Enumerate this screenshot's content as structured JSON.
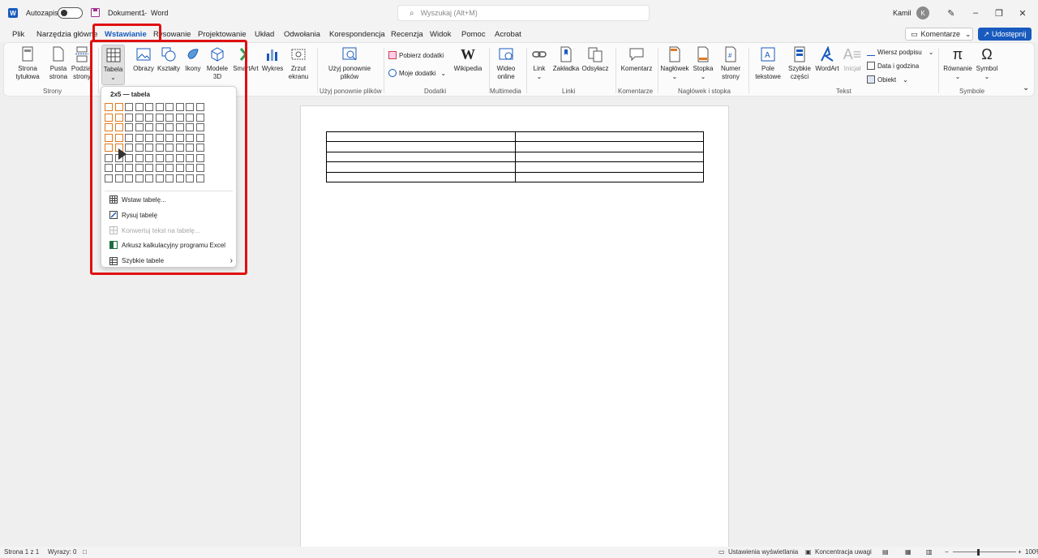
{
  "titlebar": {
    "autosave_label": "Autozapis",
    "doc_title": "Dokument1",
    "separator": "-",
    "app_name": "Word",
    "search_placeholder": "Wyszukaj (Alt+M)",
    "user_name": "Kamil",
    "avatar_letter": "K"
  },
  "tabs": [
    "Plik",
    "Narzędzia główne",
    "Wstawianie",
    "Rysowanie",
    "Projektowanie",
    "Układ",
    "Odwołania",
    "Korespondencja",
    "Recenzja",
    "Widok",
    "Pomoc",
    "Acrobat"
  ],
  "header_buttons": {
    "comments": "Komentarze",
    "share": "Udostępnij"
  },
  "ribbon": {
    "strona_tytulowa": "Strona tytułowa",
    "pusta_strona": "Pusta strona",
    "podzial_strony": "Podział strony",
    "tabela": "Tabela",
    "obrazy": "Obrazy",
    "ksztalty": "Kształty",
    "ikony": "Ikony",
    "modele_3d": "Modele 3D",
    "smartart": "SmartArt",
    "wykres": "Wykres",
    "zrzut_ekranu": "Zrzut ekranu",
    "uzyj_ponownie": "Użyj ponownie plików",
    "pobierz_dodatki": "Pobierz dodatki",
    "moje_dodatki": "Moje dodatki",
    "wikipedia": "Wikipedia",
    "wideo_online": "Wideo online",
    "link": "Link",
    "zakladka": "Zakładka",
    "odsylacz": "Odsyłacz",
    "komentarz": "Komentarz",
    "naglowek": "Nagłówek",
    "stopka": "Stopka",
    "numer_strony": "Numer strony",
    "pole_tekstowe": "Pole tekstowe",
    "szybkie_czesci": "Szybkie części",
    "wordart": "WordArt",
    "inicjal": "Inicjał",
    "wiersz_podpisu": "Wiersz podpisu",
    "data_i_godzina": "Data i godzina",
    "obiekt": "Obiekt",
    "rownanie": "Równanie",
    "symbol": "Symbol",
    "groups": {
      "strony": "Strony",
      "uzyj_ponownie_plikow": "Użyj ponownie plików",
      "dodatki": "Dodatki",
      "multimedia": "Multimedia",
      "linki": "Linki",
      "komentarze": "Komentarze",
      "naglowek_i_stopka": "Nagłówek i stopka",
      "tekst": "Tekst",
      "symbole": "Symbole"
    }
  },
  "table_dropdown": {
    "title": "2x5 — tabela",
    "grid_cols": 10,
    "grid_rows": 8,
    "selected_cols": 2,
    "selected_rows": 5,
    "items": [
      {
        "label": "Wstaw tabelę...",
        "enabled": true
      },
      {
        "label": "Rysuj tabelę",
        "enabled": true
      },
      {
        "label": "Konwertuj tekst na tabelę...",
        "enabled": false
      },
      {
        "label": "Arkusz kalkulacyjny programu Excel",
        "enabled": true
      },
      {
        "label": "Szybkie tabele",
        "enabled": true
      }
    ]
  },
  "document": {
    "table_rows": 5,
    "table_cols": 2
  },
  "statusbar": {
    "page": "Strona 1 z 1",
    "words": "Wyrazy: 0",
    "display_settings": "Ustawienia wyświetlania",
    "focus": "Koncentracja uwagi",
    "zoom": "100%"
  },
  "colors": {
    "accent": "#185abd",
    "highlight": "#e01010",
    "grid_selected": "#e07b20"
  }
}
